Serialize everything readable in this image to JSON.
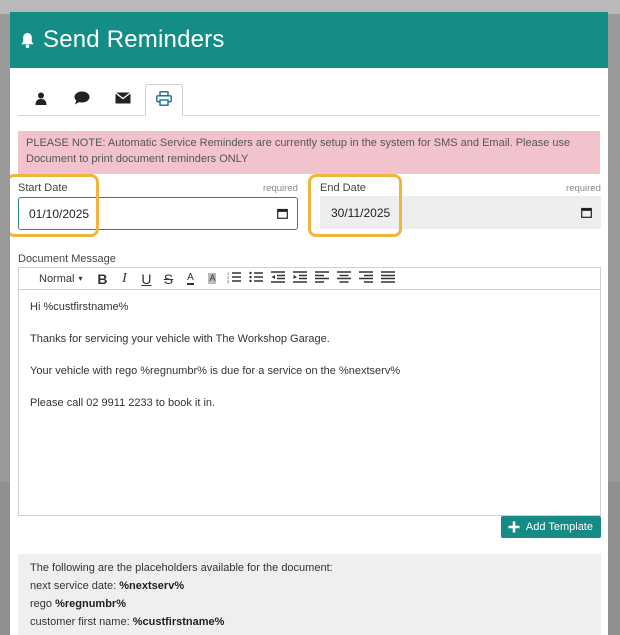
{
  "modal": {
    "title": "Send Reminders",
    "header_color": "#148d86"
  },
  "tabs": [
    {
      "icon": "user-icon",
      "active": false
    },
    {
      "icon": "chat-bubble-icon",
      "active": false
    },
    {
      "icon": "envelope-icon",
      "active": false
    },
    {
      "icon": "printer-icon",
      "active": true
    }
  ],
  "alert": {
    "text": "PLEASE NOTE: Automatic Service Reminders are currently setup in the system for SMS and Email. Please use Document to print document reminders ONLY"
  },
  "start_date": {
    "label": "Start Date",
    "required": "required",
    "value": "01/10/2025"
  },
  "end_date": {
    "label": "End Date",
    "required": "required",
    "value": "30/11/2025"
  },
  "document_message": {
    "label": "Document Message",
    "toolbar": {
      "heading_select": "Normal",
      "buttons": [
        "bold-icon",
        "italic-icon",
        "underline-icon",
        "strikethrough-icon",
        "font-color-icon",
        "background-color-icon",
        "ordered-list-icon",
        "bullet-list-icon",
        "indent-decrease-icon",
        "indent-increase-icon",
        "align-left-icon",
        "align-center-icon",
        "align-right-icon",
        "align-justify-icon"
      ]
    },
    "lines": [
      "Hi %custfirstname%",
      "Thanks for servicing your vehicle with The Workshop Garage.",
      "Your vehicle with rego %regnumbr% is due for a service on the %nextserv%",
      "Please call 02 9911 2233 to book it in."
    ]
  },
  "add_template_label": "Add Template",
  "placeholders": {
    "intro": "The following are the placeholders available for the document:",
    "items": [
      {
        "label": "next service date:",
        "code": "%nextserv%"
      },
      {
        "label": "rego",
        "code": "%regnumbr%"
      },
      {
        "label": "customer first name:",
        "code": "%custfirstname%"
      }
    ]
  },
  "colors": {
    "accent": "#148d86",
    "alert_bg": "#f2c3cc",
    "highlight": "#f0b63c"
  }
}
